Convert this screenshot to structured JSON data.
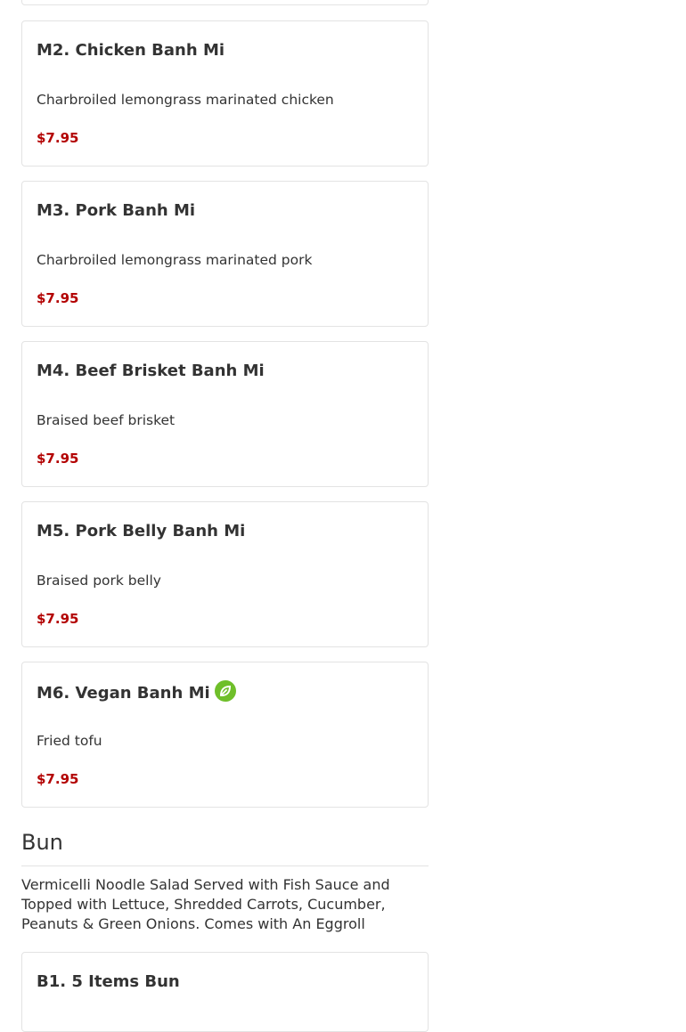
{
  "items": [
    {
      "name": "M2. Chicken Banh Mi",
      "description": "Charbroiled lemongrass marinated chicken",
      "price": "$7.95"
    },
    {
      "name": "M3. Pork Banh Mi",
      "description": "Charbroiled lemongrass marinated pork",
      "price": "$7.95"
    },
    {
      "name": "M4. Beef Brisket Banh Mi",
      "description": "Braised beef brisket",
      "price": "$7.95"
    },
    {
      "name": "M5. Pork Belly Banh Mi",
      "description": "Braised pork belly",
      "price": "$7.95"
    },
    {
      "name": "M6. Vegan Banh Mi",
      "description": "Fried tofu",
      "price": "$7.95",
      "icon": "vegan-leaf-icon"
    }
  ],
  "section": {
    "title": "Bun",
    "description": "Vermicelli Noodle Salad Served with Fish Sauce and Topped with Lettuce, Shredded Carrots, Cucumber, Peanuts & Green Onions. Comes with An Eggroll"
  },
  "next_item": {
    "name": "B1. 5 Items Bun"
  },
  "colors": {
    "price": "#b30000",
    "vegan_icon": "#6fbf2a",
    "border": "#e3e3e3"
  }
}
